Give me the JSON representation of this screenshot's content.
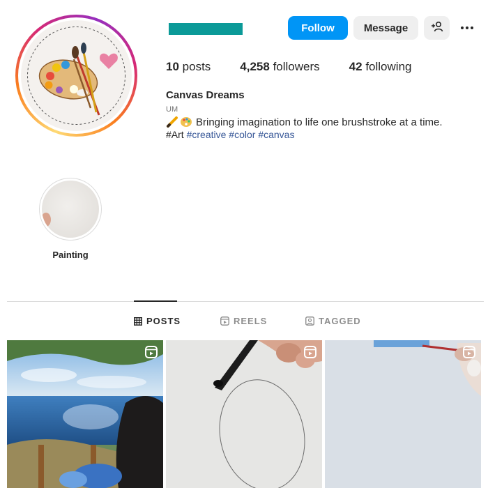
{
  "profile": {
    "full_name": "Canvas Dreams",
    "category": "UM",
    "bio_text": "Bringing imagination to life one brushstroke at a time.",
    "bio_emojis": [
      "pencil-emoji",
      "palette-emoji"
    ],
    "hashtags_plain": "#Art",
    "hashtags": [
      "#creative",
      "#color",
      "#canvas"
    ],
    "username_color": "#0b9a98"
  },
  "actions": {
    "follow_label": "Follow",
    "message_label": "Message",
    "add_user_icon": "add-user-icon",
    "more_icon": "more-icon"
  },
  "stats": {
    "posts_count": "10",
    "posts_label": "posts",
    "followers_count": "4,258",
    "followers_label": "followers",
    "following_count": "42",
    "following_label": "following"
  },
  "highlights": [
    {
      "label": "Painting"
    }
  ],
  "tabs": [
    {
      "label": "POSTS",
      "icon": "grid-icon",
      "active": true
    },
    {
      "label": "REELS",
      "icon": "reels-icon",
      "active": false
    },
    {
      "label": "TAGGED",
      "icon": "tagged-icon",
      "active": false
    }
  ],
  "posts": [
    {
      "type": "reel",
      "subject": "sea-painting"
    },
    {
      "type": "reel",
      "subject": "oval-sketch"
    },
    {
      "type": "reel",
      "subject": "blank-canvas"
    }
  ],
  "colors": {
    "accent": "#0095f6",
    "hashtag": "#385898"
  }
}
